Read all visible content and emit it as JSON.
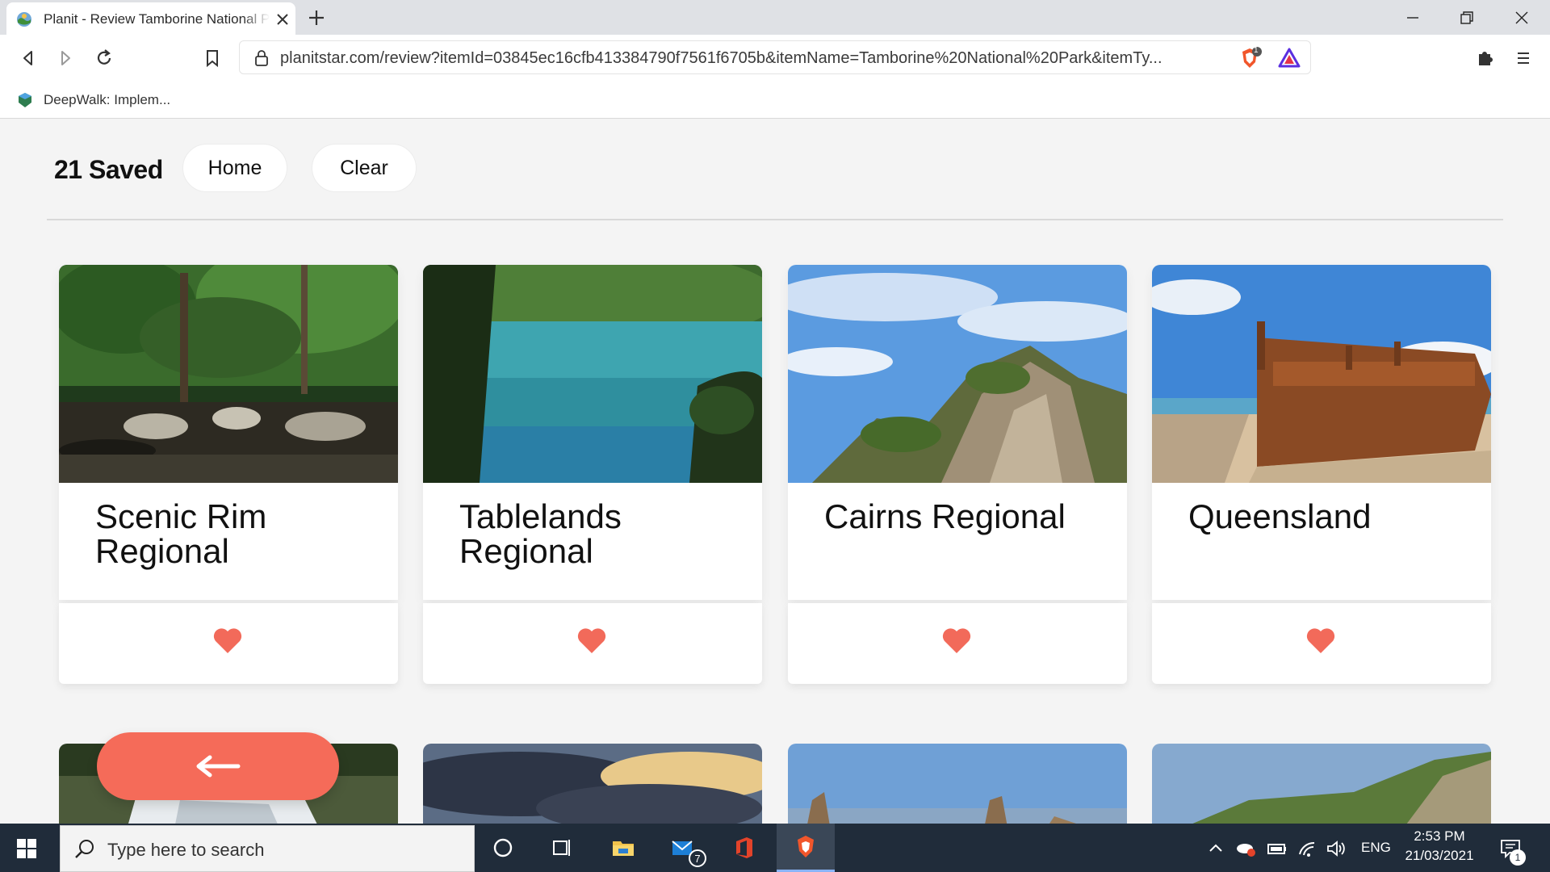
{
  "browser": {
    "tab_title": "Planit - Review Tamborine National Park",
    "url": "planitstar.com/review?itemId=03845ec16cfb413384790f7561f6705b&itemName=Tamborine%20National%20Park&itemTy...",
    "bookmark_label": "DeepWalk: Implem...",
    "shield_badge": "1"
  },
  "header": {
    "saved_count": "21 Saved",
    "home_label": "Home",
    "clear_label": "Clear"
  },
  "cards": [
    {
      "title": "Scenic Rim Regional",
      "image": "rainforest-creek",
      "liked": true
    },
    {
      "title": "Tablelands Regional",
      "image": "crater-lake",
      "liked": true
    },
    {
      "title": "Cairns Regional",
      "image": "rocky-cliff",
      "liked": true
    },
    {
      "title": "Queensland",
      "image": "shipwreck-beach",
      "liked": true
    }
  ],
  "more_cards": [
    {
      "image": "waterfall"
    },
    {
      "image": "cloudy-sunset"
    },
    {
      "image": "rock-pinnacles"
    },
    {
      "image": "mountain-ridge"
    }
  ],
  "taskbar": {
    "search_placeholder": "Type here to search",
    "mail_badge": "7",
    "language": "ENG",
    "time": "2:53 PM",
    "date": "21/03/2021",
    "notification_badge": "1"
  },
  "colors": {
    "accent": "#f56b59",
    "heart": "#f26a5a",
    "taskbar": "#202c3a"
  }
}
